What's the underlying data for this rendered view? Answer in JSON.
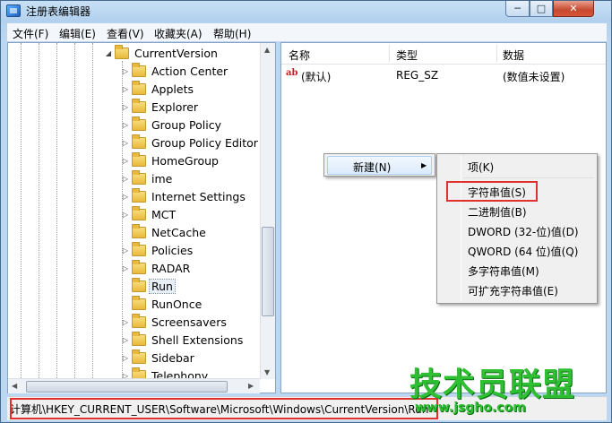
{
  "window": {
    "title": "注册表编辑器",
    "minimize_glyph": "─",
    "maximize_glyph": "□",
    "close_glyph": "✕"
  },
  "menu": [
    "文件(F)",
    "编辑(E)",
    "查看(V)",
    "收藏夹(A)",
    "帮助(H)"
  ],
  "tree": {
    "parent": "CurrentVersion",
    "items": [
      "Action Center",
      "Applets",
      "Explorer",
      "Group Policy",
      "Group Policy Editor",
      "HomeGroup",
      "ime",
      "Internet Settings",
      "MCT",
      "NetCache",
      "Policies",
      "RADAR",
      "Run",
      "RunOnce",
      "Screensavers",
      "Shell Extensions",
      "Sidebar",
      "Telephony"
    ],
    "expandable": [
      true,
      true,
      true,
      true,
      true,
      true,
      true,
      true,
      true,
      false,
      true,
      true,
      false,
      false,
      true,
      true,
      true,
      true
    ],
    "selected": "Run"
  },
  "list": {
    "columns": [
      "名称",
      "类型",
      "数据"
    ],
    "rows": [
      {
        "icon": "ab",
        "name": "(默认)",
        "type": "REG_SZ",
        "data": "(数值未设置)"
      }
    ]
  },
  "context_menu": {
    "new_label": "新建(N)",
    "submenu": [
      "项(K)",
      "字符串值(S)",
      "二进制值(B)",
      "DWORD (32-位)值(D)",
      "QWORD (64 位)值(Q)",
      "多字符串值(M)",
      "可扩充字符串值(E)"
    ],
    "highlighted": "字符串值(S)"
  },
  "status": {
    "path": "计算机\\HKEY_CURRENT_USER\\Software\\Microsoft\\Windows\\CurrentVersion\\Run"
  },
  "watermark": {
    "text": "技术员联盟",
    "url": "www.jsgho.com"
  },
  "colors": {
    "highlight_box": "#e03131",
    "watermark": "#2fbf32"
  }
}
